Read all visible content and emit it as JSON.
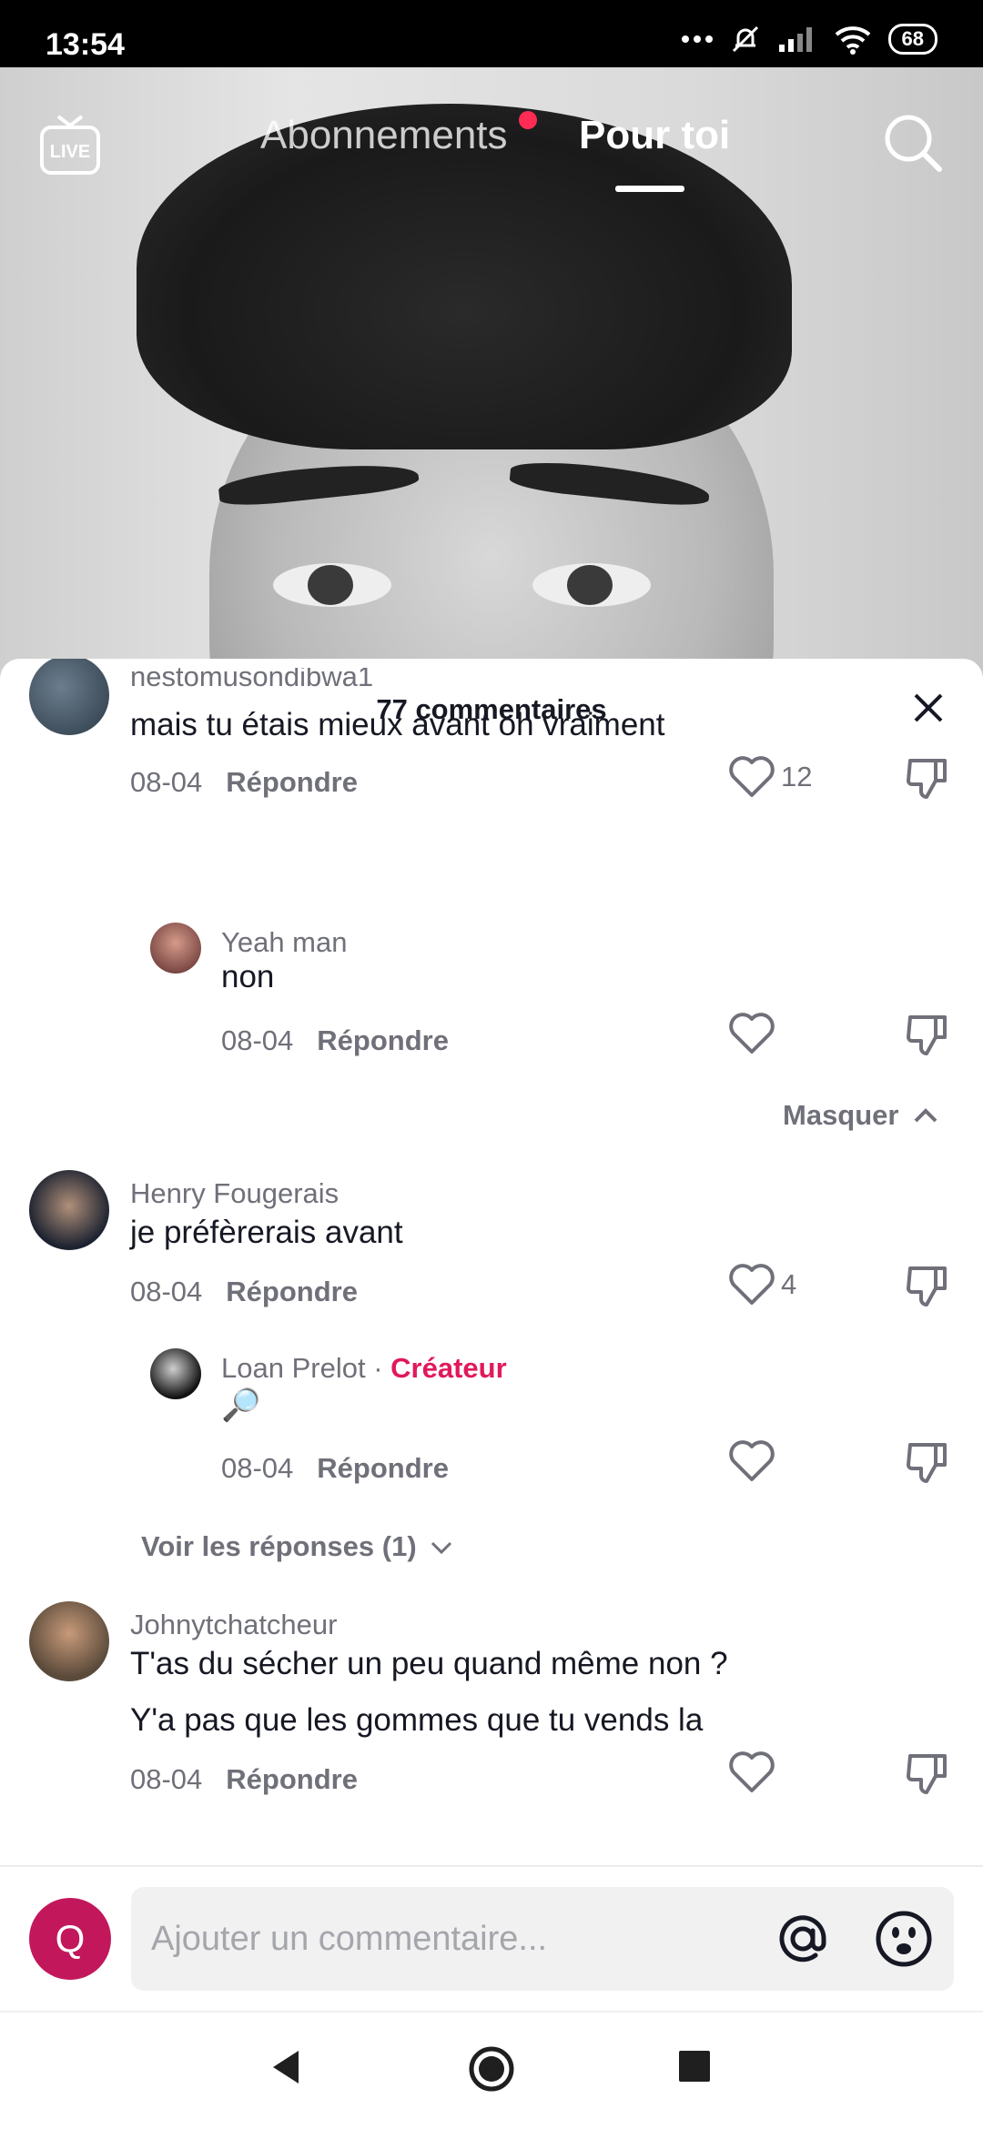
{
  "status_bar": {
    "time": "13:54",
    "battery": "68"
  },
  "nav": {
    "live_label": "LIVE",
    "tab_following": "Abonnements",
    "tab_foryou": "Pour toi"
  },
  "sheet": {
    "title": "77 commentaires"
  },
  "comments": [
    {
      "username": "nestomusondibwa1",
      "text": "mais tu étais mieux avant oh vraiment",
      "date": "08-04",
      "reply_label": "Répondre",
      "likes": "12",
      "replies": [
        {
          "username": "Yeah man",
          "text": "non",
          "date": "08-04",
          "reply_label": "Répondre"
        }
      ],
      "hide_label": "Masquer"
    },
    {
      "username": "Henry Fougerais",
      "text": "je préfèrerais avant",
      "date": "08-04",
      "reply_label": "Répondre",
      "likes": "4",
      "replies": [
        {
          "username": "Loan Prelot",
          "separator": "·",
          "badge": "Créateur",
          "text": "🔎",
          "date": "08-04",
          "reply_label": "Répondre"
        }
      ],
      "view_replies_label": "Voir les réponses (1)"
    },
    {
      "username": "Johnytchatcheur",
      "text_line1": "T'as du sécher un peu quand même non ?",
      "text_line2": "Y'a pas que les gommes que tu vends la",
      "date": "08-04",
      "reply_label": "Répondre"
    }
  ],
  "composer": {
    "avatar_letter": "Q",
    "placeholder": "Ajouter un commentaire..."
  },
  "colors": {
    "accent_red": "#fe2c55",
    "creator": "#e0195a",
    "avatar_me": "#c2185b"
  },
  "icons": [
    "live-icon",
    "search-icon",
    "close-icon",
    "heart-icon",
    "dislike-icon",
    "chevron-up-icon",
    "chevron-down-icon",
    "at-icon",
    "emoji-icon",
    "back-icon",
    "home-icon",
    "recents-icon"
  ]
}
